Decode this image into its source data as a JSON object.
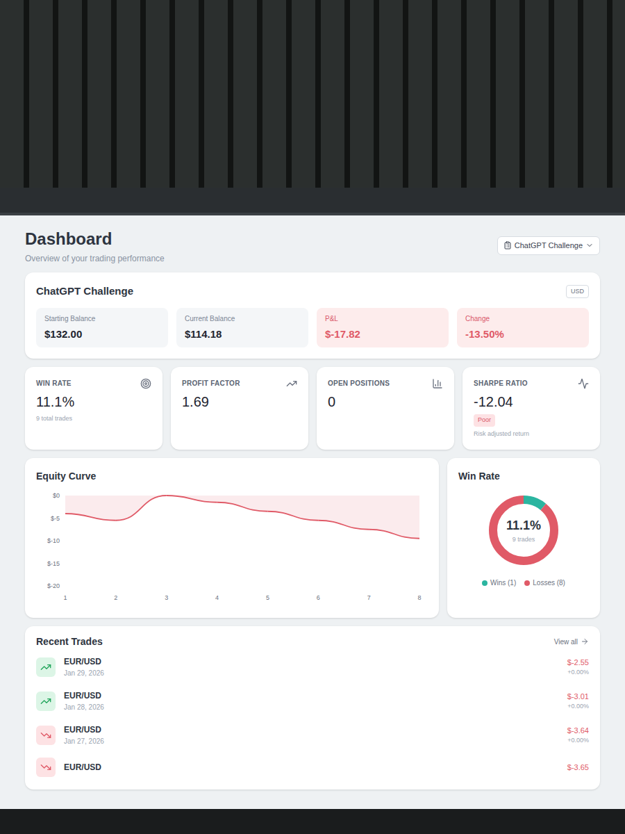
{
  "header": {
    "title": "Dashboard",
    "subtitle": "Overview of your trading performance",
    "account_selector": "ChatGPT Challenge"
  },
  "account": {
    "name": "ChatGPT Challenge",
    "currency": "USD",
    "stats": [
      {
        "label": "Starting Balance",
        "value": "$132.00",
        "kind": "neutral"
      },
      {
        "label": "Current Balance",
        "value": "$114.18",
        "kind": "neutral"
      },
      {
        "label": "P&L",
        "value": "$-17.82",
        "kind": "negative"
      },
      {
        "label": "Change",
        "value": "-13.50%",
        "kind": "negative"
      }
    ]
  },
  "metrics": [
    {
      "label": "WIN RATE",
      "value": "11.1%",
      "note": "9 total trades",
      "kind": "win-rate"
    },
    {
      "label": "PROFIT FACTOR",
      "value": "1.69",
      "kind": "profit-factor"
    },
    {
      "label": "OPEN POSITIONS",
      "value": "0",
      "kind": "open-positions"
    },
    {
      "label": "SHARPE RATIO",
      "value": "-12.04",
      "badge": "Poor",
      "note": "Risk adjusted return",
      "kind": "sharpe"
    }
  ],
  "equity_curve": {
    "title": "Equity Curve",
    "y_ticks": [
      "$0",
      "$-5",
      "$-10",
      "$-15",
      "$-20"
    ],
    "y_max": 0,
    "y_min": -20,
    "x_ticks": [
      "1",
      "2",
      "3",
      "4",
      "5",
      "6",
      "7",
      "8"
    ],
    "series": [
      {
        "name": "equity",
        "values": [
          -4,
          -5.5,
          0,
          -1.5,
          -3.5,
          -5.5,
          -7.5,
          -9.5
        ],
        "color": "#e05a67"
      }
    ]
  },
  "win_rate": {
    "title": "Win Rate",
    "value": "11.1%",
    "note": "9 trades",
    "segments": [
      {
        "label": "Wins (1)",
        "value": 1,
        "color": "#2bb5a0"
      },
      {
        "label": "Losses (8)",
        "value": 8,
        "color": "#e05a67"
      }
    ]
  },
  "recent_trades": {
    "title": "Recent Trades",
    "view_all": "View all",
    "rows": [
      {
        "pair": "EUR/USD",
        "date": "Jan 29, 2026",
        "pnl": "$-2.55",
        "change": "+0.00%",
        "kind": "long"
      },
      {
        "pair": "EUR/USD",
        "date": "Jan 28, 2026",
        "pnl": "$-3.01",
        "change": "+0.00%",
        "kind": "long"
      },
      {
        "pair": "EUR/USD",
        "date": "Jan 27, 2026",
        "pnl": "$-3.64",
        "change": "+0.00%",
        "kind": "short"
      },
      {
        "pair": "EUR/USD",
        "pnl": "$-3.65",
        "kind": "short"
      }
    ]
  }
}
